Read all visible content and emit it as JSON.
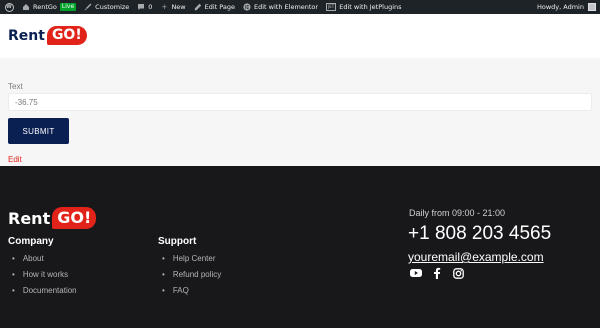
{
  "adminbar": {
    "site_name": "RentGo",
    "live_badge": "Live",
    "customize": "Customize",
    "comments_count": "0",
    "new_label": "New",
    "edit_page": "Edit Page",
    "edit_elementor": "Edit with Elementor",
    "jet_icon_text": "JET",
    "edit_jetplugins": "Edit with JetPlugins",
    "howdy": "Howdy, Admin"
  },
  "header": {
    "logo_text": "Rent",
    "logo_badge": "GO!"
  },
  "form": {
    "field_label": "Text",
    "field_value": "-36.75",
    "submit_label": "SUBMIT",
    "edit_link": "Edit"
  },
  "footer": {
    "logo_text": "Rent",
    "logo_badge": "GO!",
    "company": {
      "title": "Company",
      "items": [
        "About",
        "How it works",
        "Documentation"
      ]
    },
    "support": {
      "title": "Support",
      "items": [
        "Help Center",
        "Refund policy",
        "FAQ"
      ]
    },
    "contact": {
      "hours": "Daily from 09:00 - 21:00",
      "phone": "+1 808 203 4565",
      "email": "youremail@example.com"
    },
    "socials": [
      "youtube-icon",
      "facebook-icon",
      "instagram-icon"
    ]
  },
  "colors": {
    "brand_navy": "#0a1f52",
    "brand_red": "#e2231a",
    "footer_bg": "#18181b",
    "adminbar_bg": "#1d2327"
  }
}
